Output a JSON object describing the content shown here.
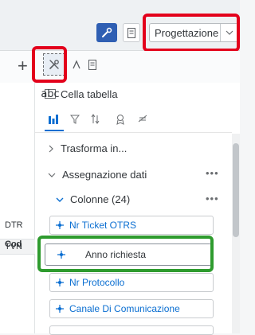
{
  "header": {
    "mode_select": {
      "value": "Progettazione"
    },
    "icons": [
      "wrench-screwdriver-icon",
      "document-icon",
      "chevron-down-icon"
    ]
  },
  "toolbar": {
    "add_label": "+"
  },
  "panel": {
    "title": "Cella tabella",
    "tabs": [
      "data-tab-icon",
      "filter-icon",
      "sort-icon",
      "ranking-icon",
      "conditional-icon"
    ],
    "sections": {
      "transform": {
        "label": "Trasforma in..."
      },
      "assign": {
        "label": "Assegnazione dati",
        "more": "•••"
      },
      "columns": {
        "label": "Colonne (24)",
        "more": "•••"
      }
    },
    "fields": [
      {
        "label": "Nr Ticket OTRS"
      },
      {
        "label": "Anno richiesta"
      },
      {
        "label": "Nr Protocollo"
      },
      {
        "label": "Canale Di Comunicazione"
      }
    ]
  },
  "left_table": {
    "header": "Cod",
    "cells": [
      "DTR",
      "TVN"
    ]
  },
  "highlights": {
    "red": "#e3001b",
    "green": "#2e9b2e",
    "accent": "#0a6ed1"
  }
}
